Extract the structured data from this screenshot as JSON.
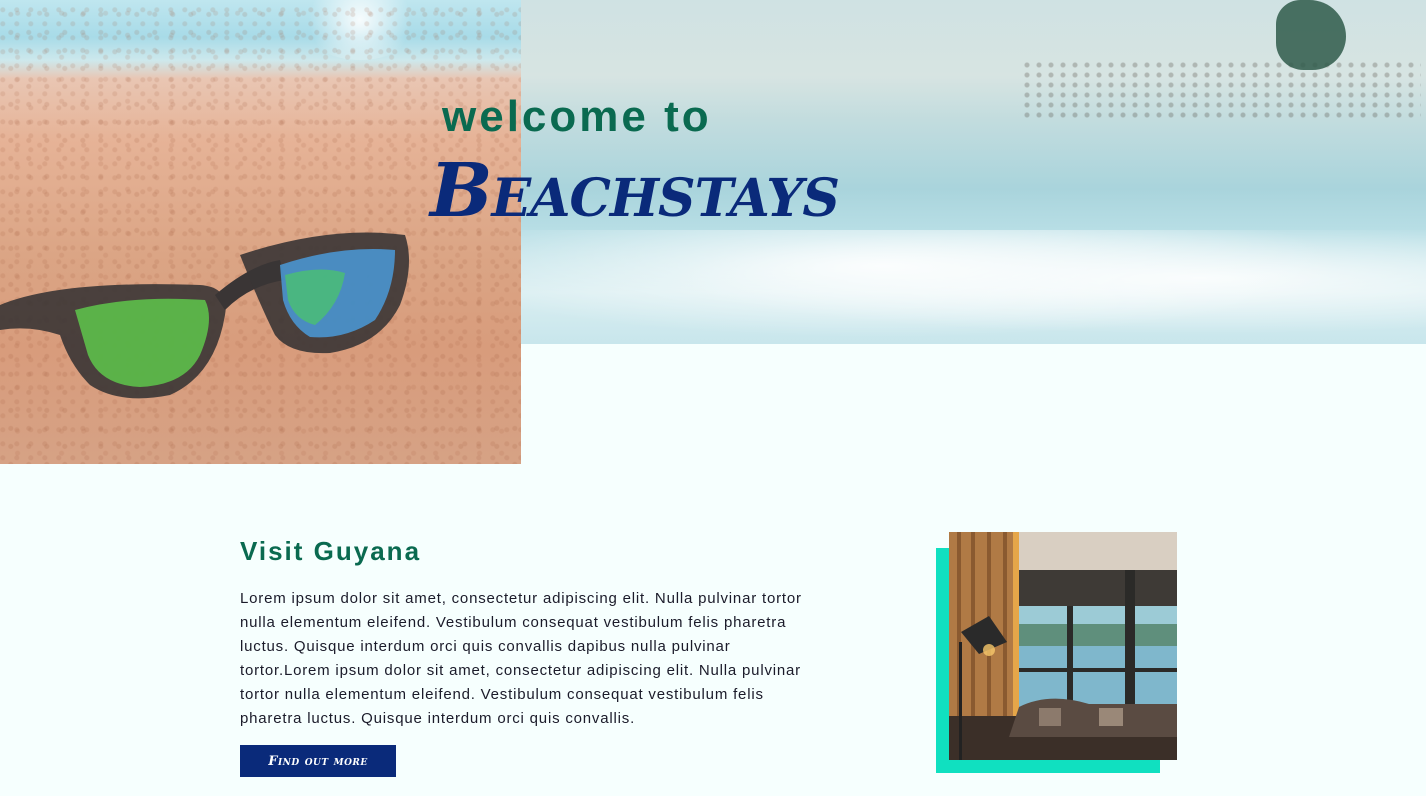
{
  "hero": {
    "welcome_text": "welcome to",
    "brand_name": "Beachstays"
  },
  "intro": {
    "title": "Visit Guyana",
    "body": "Lorem ipsum dolor sit amet, consectetur adipiscing elit. Nulla pulvinar tortor nulla elementum eleifend. Vestibulum consequat vestibulum felis pharetra luctus. Quisque interdum orci quis convallis dapibus nulla pulvinar tortor.Lorem ipsum dolor sit amet, consectetur adipiscing elit. Nulla pulvinar tortor nulla elementum eleifend. Vestibulum consequat vestibulum felis pharetra luctus. Quisque interdum orci quis convallis.",
    "button_label": "Find out more"
  },
  "colors": {
    "page_background": "#f6fffe",
    "heading_green": "#0a6a50",
    "brand_navy": "#0a2a7a",
    "accent_teal": "#10e0c0"
  }
}
